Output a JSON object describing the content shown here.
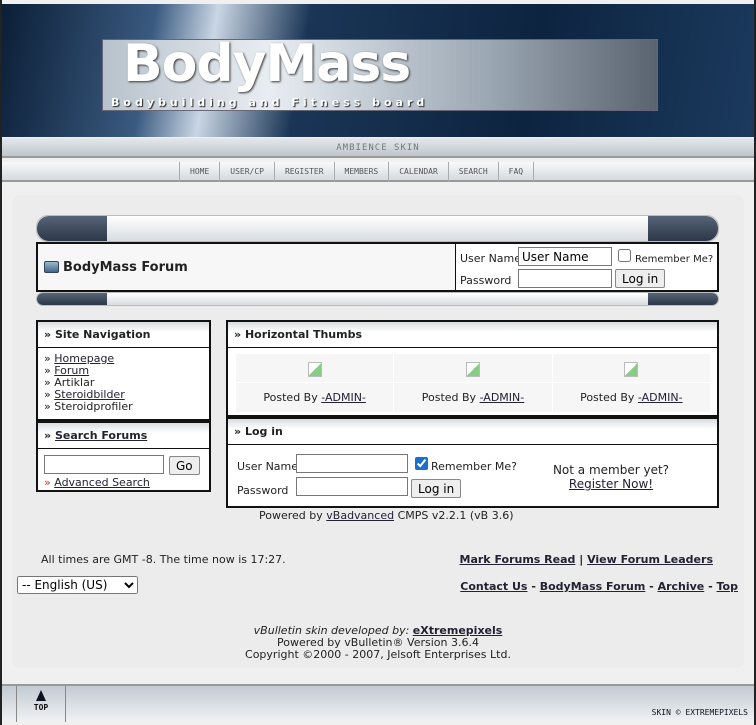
{
  "header": {
    "logo_text": "BodyMass",
    "tagline": "Bodybuilding and Fitness board",
    "skin": "AMBIENCE SKIN"
  },
  "nav": [
    {
      "label": "HOME"
    },
    {
      "label": "USER/CP"
    },
    {
      "label": "REGISTER"
    },
    {
      "label": "MEMBERS"
    },
    {
      "label": "CALENDAR"
    },
    {
      "label": "SEARCH"
    },
    {
      "label": "FAQ"
    }
  ],
  "forum": {
    "title": "BodyMass Forum",
    "username_label": "User Name",
    "username_value": "User Name",
    "password_label": "Password",
    "remember_label": "Remember Me?",
    "remember_checked": false,
    "login_label": "Log in"
  },
  "site_nav": {
    "title": "Site Navigation",
    "items": [
      {
        "label": "Homepage",
        "link": true
      },
      {
        "label": "Forum",
        "link": true
      },
      {
        "label": "Artiklar",
        "link": false
      },
      {
        "label": "Steroidbilder",
        "link": true
      },
      {
        "label": "Steroidprofiler",
        "link": false
      }
    ]
  },
  "search": {
    "title": "Search Forums",
    "go_label": "Go",
    "advanced_label": "Advanced Search"
  },
  "thumbs": {
    "title": "Horizontal Thumbs",
    "items": [
      {
        "posted_by": "Posted By",
        "author": "-ADMIN-"
      },
      {
        "posted_by": "Posted By",
        "author": "-ADMIN-"
      },
      {
        "posted_by": "Posted By",
        "author": "-ADMIN-"
      }
    ]
  },
  "login": {
    "title": "Log in",
    "username_label": "User Name",
    "password_label": "Password",
    "remember_label": "Remember Me?",
    "remember_checked": true,
    "login_label": "Log in",
    "not_member": "Not a member yet?",
    "register_label": "Register Now!"
  },
  "powered": {
    "prefix": "Powered by",
    "link": "vBadvanced",
    "suffix": "CMPS v2.2.1 (vB 3.6)"
  },
  "time_text": "All times are GMT -8. The time now is 17:27.",
  "links1": [
    "Mark Forums Read",
    "View Forum Leaders"
  ],
  "language": "-- English (US)",
  "links2": [
    "Contact Us",
    "BodyMass Forum",
    "Archive",
    "Top"
  ],
  "credits": {
    "dev_prefix": "vBulletin skin developed by:",
    "dev_link": "eXtremepixels",
    "powered": "Powered by vBulletin® Version 3.6.4",
    "copyright": "Copyright ©2000 - 2007, Jelsoft Enterprises Ltd."
  },
  "footer": {
    "top_label": "TOP",
    "skin_credit": "SKIN © EXTREMEPIXELS"
  }
}
